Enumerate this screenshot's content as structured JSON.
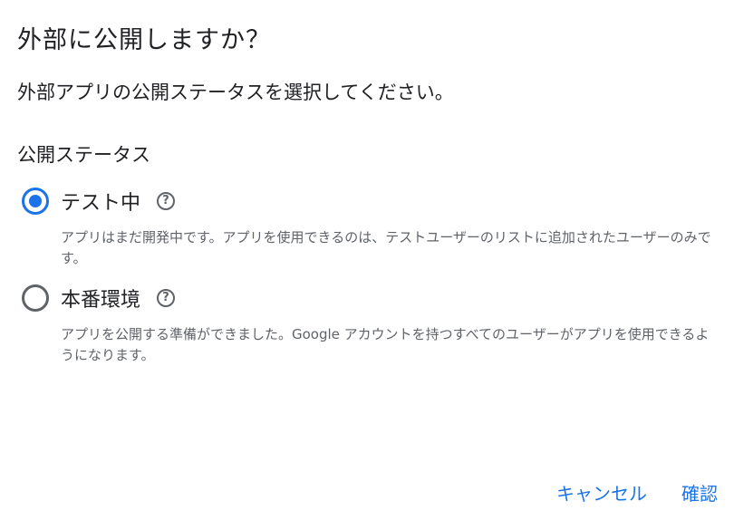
{
  "dialog": {
    "title": "外部に公開しますか？",
    "description": "外部アプリの公開ステータスを選択してください。",
    "section_heading": "公開ステータス"
  },
  "options": [
    {
      "label": "テスト中",
      "selected": true,
      "help_icon": "help-circle-icon",
      "help_glyph": "?",
      "description": "アプリはまだ開発中です。アプリを使用できるのは、テストユーザーのリストに追加されたユーザーのみです。"
    },
    {
      "label": "本番環境",
      "selected": false,
      "help_icon": "help-circle-icon",
      "help_glyph": "?",
      "description": "アプリを公開する準備ができました。Google アカウントを持つすべてのユーザーがアプリを使用できるようになります。"
    }
  ],
  "actions": {
    "cancel_label": "キャンセル",
    "confirm_label": "確認"
  },
  "colors": {
    "accent": "#1a73e8",
    "text_primary": "#202124",
    "text_secondary": "#5f6368"
  }
}
